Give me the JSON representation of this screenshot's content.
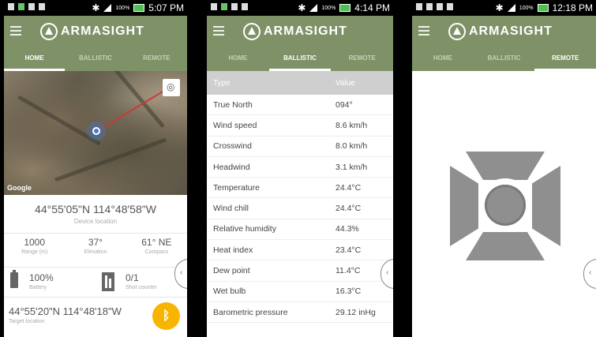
{
  "app": {
    "brand": "ARMASIGHT"
  },
  "tabs": [
    "HOME",
    "BALLISTIC",
    "REMOTE"
  ],
  "screens": [
    {
      "status_time": "5:07 PM",
      "battery_pct": "100%",
      "active_tab": "HOME"
    },
    {
      "status_time": "4:14 PM",
      "battery_pct": "100%",
      "active_tab": "BALLISTIC"
    },
    {
      "status_time": "12:18 PM",
      "battery_pct": "100%",
      "active_tab": "REMOTE"
    }
  ],
  "home": {
    "map_attribution": "Google",
    "device_coords": "44°55'05\"N 114°48'58\"W",
    "device_location_label": "Device location",
    "stats": [
      {
        "value": "1000",
        "label": "Range (m)"
      },
      {
        "value": "37°",
        "label": "Elevation"
      },
      {
        "value": "61° NE",
        "label": "Compass"
      }
    ],
    "battery": {
      "value": "100%",
      "label": "Battery"
    },
    "shot_counter": {
      "value": "0/1",
      "label": "Shot counter"
    },
    "target_coords": "44°55'20\"N 114°48'18\"W",
    "target_location_label": "Target location",
    "bluetooth_glyph": "ᛒ"
  },
  "ballistic": {
    "header": {
      "type": "Type",
      "value": "Value"
    },
    "rows": [
      {
        "type": "True North",
        "value": "094°"
      },
      {
        "type": "Wind speed",
        "value": "8.6 km/h"
      },
      {
        "type": "Crosswind",
        "value": "8.0 km/h"
      },
      {
        "type": "Headwind",
        "value": "3.1 km/h"
      },
      {
        "type": "Temperature",
        "value": "24.4°C"
      },
      {
        "type": "Wind chill",
        "value": "24.4°C"
      },
      {
        "type": "Relative humidity",
        "value": "44.3%"
      },
      {
        "type": "Heat index",
        "value": "23.4°C"
      },
      {
        "type": "Dew point",
        "value": "11.4°C"
      },
      {
        "type": "Wet bulb",
        "value": "16.3°C"
      },
      {
        "type": "Barometric pressure",
        "value": "29.12 inHg"
      }
    ]
  },
  "side_tab_glyph": "‹",
  "colors": {
    "appbar": "#7f9267",
    "fab": "#f7b400",
    "remote_pad": "#8f8f8f"
  }
}
